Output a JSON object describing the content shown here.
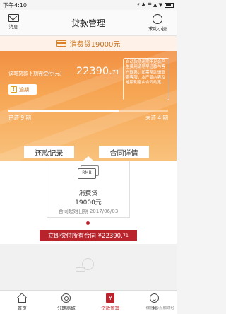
{
  "status_bar": {
    "time": "下午4:10",
    "icons_text": "⚡ ✱ ☰ ▲ ▼"
  },
  "nav": {
    "title": "贷款管理",
    "left_label": "消息",
    "right_label": "求助小捷"
  },
  "hero": {
    "header_text": "消费贷19000元",
    "due_label": "该笔贷款下期需偿付(元)",
    "due_amount_main": "22390.",
    "due_amount_cents": "71",
    "overdue_label": "逾期",
    "overdue_icon_glyph": "!",
    "notice_text": "自动款期逾期不足会产生费用请尽早还款与客户联系，如需帮助请联系客服，本产品内容及逾期利息由合同约定。",
    "paid_label": "已还 9 期",
    "unpaid_label": "未还 4 期",
    "progress_fraction": 0.69
  },
  "buttons": {
    "records": "还款记录",
    "contract": "合同详情"
  },
  "loan": {
    "rmb_label": "RMB",
    "name": "消费贷",
    "amount": "19000元",
    "date": "合同起始日期 2017/06/03",
    "pay_all_main": "立即偿付所有合同 ¥22390.",
    "pay_all_cents": "71"
  },
  "tabs": [
    {
      "label": "首页",
      "icon": "home-icon"
    },
    {
      "label": "分期商城",
      "icon": "mall-icon"
    },
    {
      "label": "贷款管理",
      "icon": "loan-icon",
      "glyph": "¥"
    },
    {
      "label": "我",
      "icon": "me-icon"
    }
  ],
  "watermark": "微信 @点融财经",
  "colors": {
    "accent": "#b8232c",
    "hero_top": "#f0883d",
    "hero_bottom": "#f9c27c"
  }
}
